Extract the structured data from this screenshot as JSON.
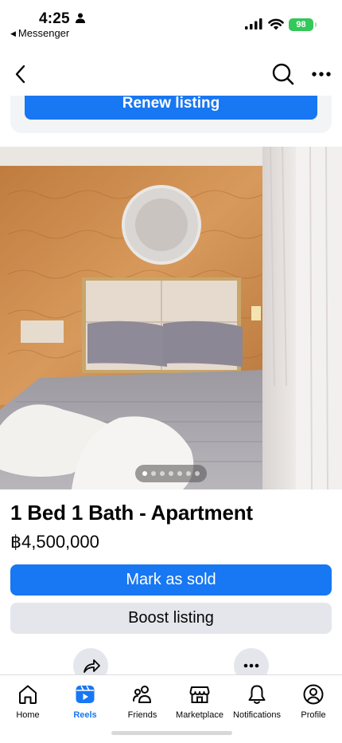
{
  "status_bar": {
    "time": "4:25",
    "back_app_label": "Messenger",
    "battery": "98"
  },
  "nav": {
    "back_icon": "chevron-left-icon",
    "search_icon": "search-icon",
    "more_icon": "more-horizontal-icon"
  },
  "renew": {
    "label": "Renew listing"
  },
  "photo": {
    "pager_count": 7,
    "pager_active_index": 0
  },
  "listing": {
    "title": "1 Bed 1 Bath - Apartment",
    "price": "฿4,500,000"
  },
  "actions": {
    "mark_sold_label": "Mark as sold",
    "boost_label": "Boost listing"
  },
  "tabs": [
    {
      "label": "Home",
      "icon": "home-icon",
      "active": false
    },
    {
      "label": "Reels",
      "icon": "reels-icon",
      "active": true
    },
    {
      "label": "Friends",
      "icon": "friends-icon",
      "active": false
    },
    {
      "label": "Marketplace",
      "icon": "marketplace-icon",
      "active": false
    },
    {
      "label": "Notifications",
      "icon": "bell-icon",
      "active": false
    },
    {
      "label": "Profile",
      "icon": "profile-icon",
      "active": false
    }
  ],
  "colors": {
    "accent": "#1877f2",
    "secondary_button": "#e4e6eb",
    "battery": "#34c759"
  }
}
